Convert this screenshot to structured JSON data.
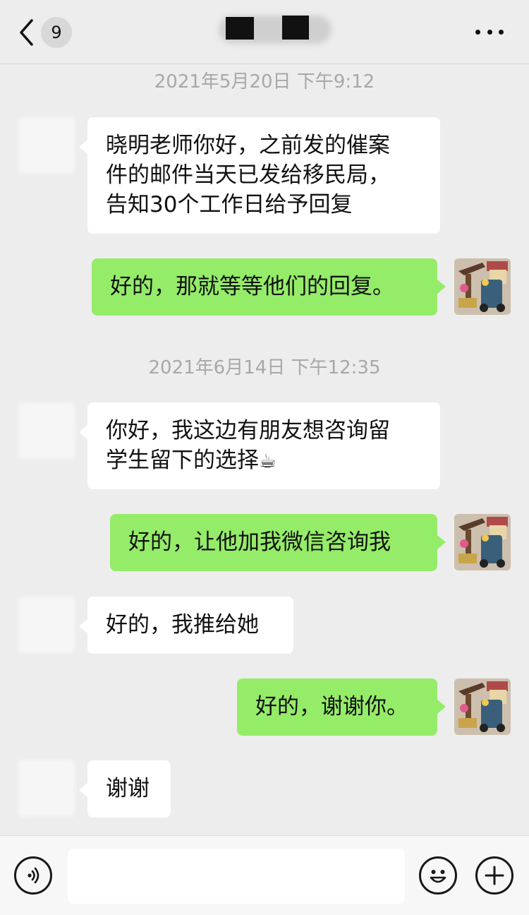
{
  "header": {
    "unread_count": "9"
  },
  "timestamps": {
    "t1": "2021年5月20日 下午9:12",
    "t2": "2021年6月14日 下午12:35"
  },
  "messages": [
    {
      "dir": "in",
      "lines": [
        "晓明老师你好，之前发的催案",
        "件的邮件当天已发给移民局，",
        "告知30个工作日给予回复"
      ]
    },
    {
      "dir": "out",
      "lines": [
        "好的，那就等等他们的回复。"
      ]
    },
    {
      "dir": "in",
      "lines": [
        "你好，我这边有朋友想咨询留",
        "学生留下的选择"
      ],
      "emoji": "☕"
    },
    {
      "dir": "out",
      "lines": [
        "好的，让他加我微信咨询我"
      ]
    },
    {
      "dir": "in",
      "lines": [
        "好的，我推给她"
      ]
    },
    {
      "dir": "out",
      "lines": [
        "好的，谢谢你。"
      ]
    },
    {
      "dir": "in",
      "lines": [
        "谢谢"
      ]
    }
  ],
  "input_bar": {
    "placeholder": "",
    "icons": [
      "voice-icon",
      "emoji-icon",
      "plus-icon"
    ]
  },
  "colors": {
    "background": "#ededed",
    "outgoing_bubble": "#95ec69",
    "incoming_bubble": "#ffffff",
    "timestamp": "#a8a8a8"
  }
}
